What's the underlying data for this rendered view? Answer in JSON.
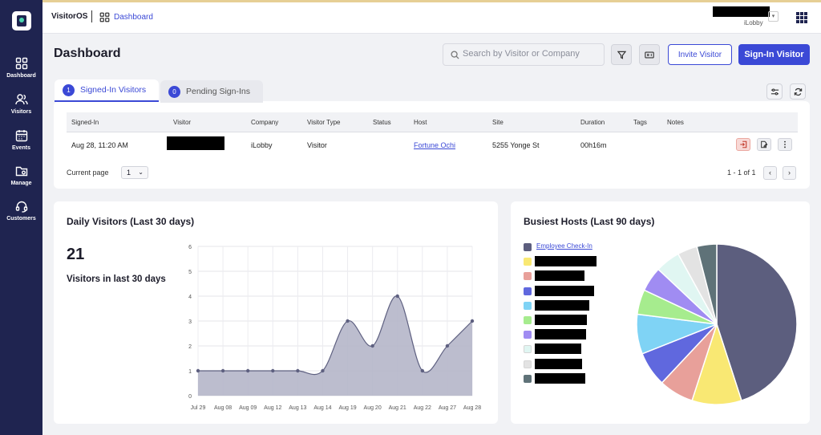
{
  "app": {
    "brand": "VisitorOS",
    "breadcrumb": "Dashboard",
    "org_label": "iLobby"
  },
  "sidebar": {
    "items": [
      {
        "label": "Dashboard",
        "icon": "dashboard-grid-icon"
      },
      {
        "label": "Visitors",
        "icon": "users-icon"
      },
      {
        "label": "Events",
        "icon": "calendar-icon"
      },
      {
        "label": "Manage",
        "icon": "folder-gear-icon"
      },
      {
        "label": "Customers",
        "icon": "headset-icon"
      }
    ]
  },
  "header": {
    "title": "Dashboard",
    "search_placeholder": "Search by Visitor or Company",
    "invite_label": "Invite Visitor",
    "signin_label": "Sign-In Visitor"
  },
  "tabs": [
    {
      "count": "1",
      "label": "Signed-In Visitors"
    },
    {
      "count": "0",
      "label": "Pending Sign-Ins"
    }
  ],
  "table": {
    "columns": [
      "Signed-In",
      "Visitor",
      "Company",
      "Visitor Type",
      "Status",
      "Host",
      "Site",
      "Duration",
      "Tags",
      "Notes"
    ],
    "rows": [
      {
        "signed_in": "Aug 28, 11:20 AM",
        "visitor": "",
        "company": "iLobby",
        "visitor_type": "Visitor",
        "status": "",
        "host": "Fortune Ochi",
        "site": "5255 Yonge St",
        "duration": "00h16m",
        "tags": "",
        "notes": ""
      }
    ],
    "current_page_label": "Current page",
    "current_page_value": "1",
    "pagination_text": "1 - 1 of 1"
  },
  "daily": {
    "title": "Daily Visitors (Last 30 days)",
    "count": "21",
    "caption": "Visitors in last 30 days"
  },
  "hosts": {
    "title": "Busiest Hosts (Last 90 days)",
    "first_legend": "Employee Check-In"
  },
  "chart_data": [
    {
      "type": "area",
      "title": "Daily Visitors (Last 30 days)",
      "x": [
        "Jul 29",
        "Aug 08",
        "Aug 09",
        "Aug 12",
        "Aug 13",
        "Aug 14",
        "Aug 19",
        "Aug 20",
        "Aug 21",
        "Aug 22",
        "Aug 27",
        "Aug 28"
      ],
      "y": [
        1,
        1,
        1,
        1,
        1,
        1,
        3,
        2,
        4,
        1,
        2,
        3
      ],
      "ylim": [
        0,
        6
      ],
      "yticks": [
        "0",
        "1",
        "2",
        "3",
        "4",
        "5",
        "6"
      ],
      "grid": true,
      "color": "#b5b6c9",
      "line_color": "#5e6080"
    },
    {
      "type": "pie",
      "title": "Busiest Hosts (Last 90 days)",
      "slices": [
        {
          "label": "Employee Check-In",
          "value": 45,
          "color": "#5c5e7e"
        },
        {
          "label": "",
          "value": 10,
          "color": "#f9e873"
        },
        {
          "label": "",
          "value": 7,
          "color": "#e8a09a"
        },
        {
          "label": "",
          "value": 7,
          "color": "#6068de"
        },
        {
          "label": "",
          "value": 8,
          "color": "#7fd3f5"
        },
        {
          "label": "",
          "value": 5,
          "color": "#a6ec8e"
        },
        {
          "label": "",
          "value": 5,
          "color": "#a08cf2"
        },
        {
          "label": "",
          "value": 5,
          "color": "#e0f6f2"
        },
        {
          "label": "",
          "value": 4,
          "color": "#e3e3e3"
        },
        {
          "label": "",
          "value": 4,
          "color": "#5f7278"
        }
      ]
    }
  ]
}
